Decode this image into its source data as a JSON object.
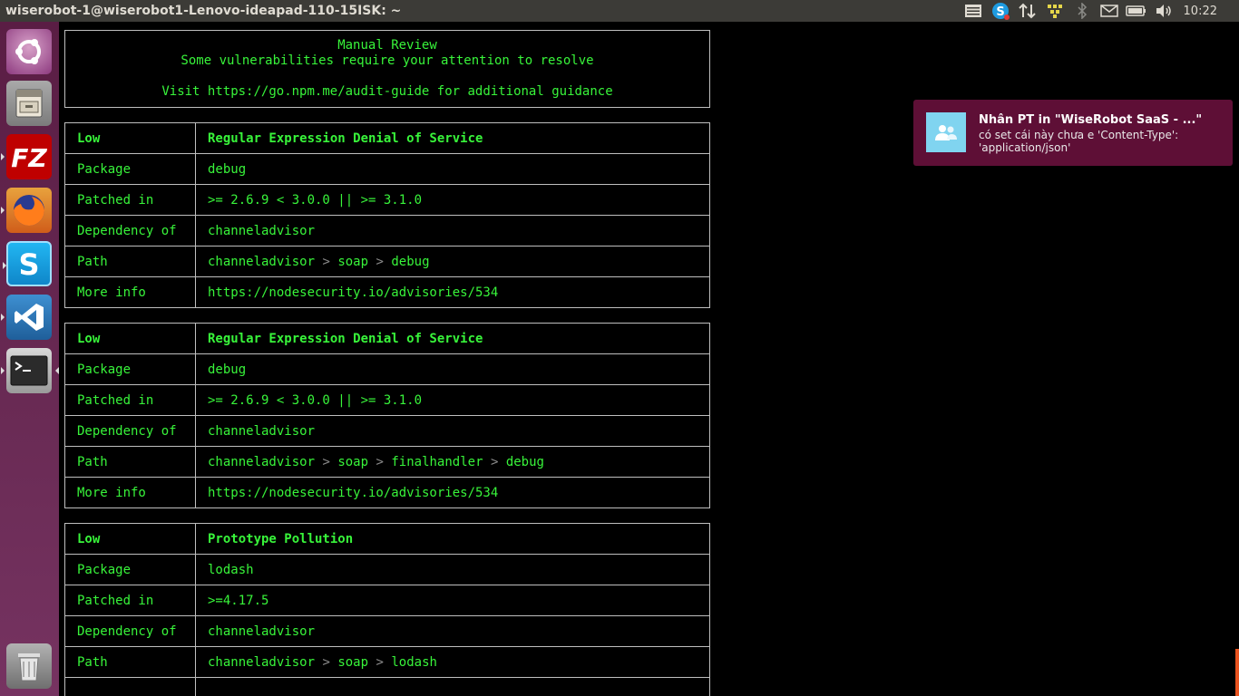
{
  "window": {
    "title": "wiserobot-1@wiserobot1-Lenovo-ideapad-110-15ISK: ~"
  },
  "tray": {
    "clock": "10:22"
  },
  "launcher": {
    "items": [
      {
        "name": "ubuntu-dash"
      },
      {
        "name": "files"
      },
      {
        "name": "filezilla"
      },
      {
        "name": "firefox"
      },
      {
        "name": "skype"
      },
      {
        "name": "vscode"
      },
      {
        "name": "terminal"
      },
      {
        "name": "trash"
      }
    ]
  },
  "terminal": {
    "header": {
      "line1": "Manual Review",
      "line2": "Some vulnerabilities require your attention to resolve",
      "line3": "Visit https://go.npm.me/audit-guide for additional guidance"
    },
    "labels": {
      "package": "Package",
      "patched": "Patched in",
      "dependency": "Dependency of",
      "path": "Path",
      "more_info": "More info",
      "path_sep": ">"
    },
    "advisories": [
      {
        "severity": "Low",
        "title": "Regular Expression Denial of Service",
        "package": "debug",
        "patched": ">= 2.6.9 < 3.0.0 || >= 3.1.0",
        "dependency": "channeladvisor",
        "path": [
          "channeladvisor",
          "soap",
          "debug"
        ],
        "more_info": "https://nodesecurity.io/advisories/534"
      },
      {
        "severity": "Low",
        "title": "Regular Expression Denial of Service",
        "package": "debug",
        "patched": ">= 2.6.9 < 3.0.0 || >= 3.1.0",
        "dependency": "channeladvisor",
        "path": [
          "channeladvisor",
          "soap",
          "finalhandler",
          "debug"
        ],
        "more_info": "https://nodesecurity.io/advisories/534"
      },
      {
        "severity": "Low",
        "title": "Prototype Pollution",
        "package": "lodash",
        "patched": ">=4.17.5",
        "dependency": "channeladvisor",
        "path": [
          "channeladvisor",
          "soap",
          "lodash"
        ]
      }
    ]
  },
  "notification": {
    "title": "Nhân PT in \"WiseRobot SaaS - ...\"",
    "body": "có set cái này chưa e  'Content-Type': 'application/json'"
  },
  "colors": {
    "terminal_text": "#38f43a",
    "terminal_bg": "#000000",
    "notification_bg": "#5e0f36",
    "topbar_bg": "#3c3b37"
  }
}
